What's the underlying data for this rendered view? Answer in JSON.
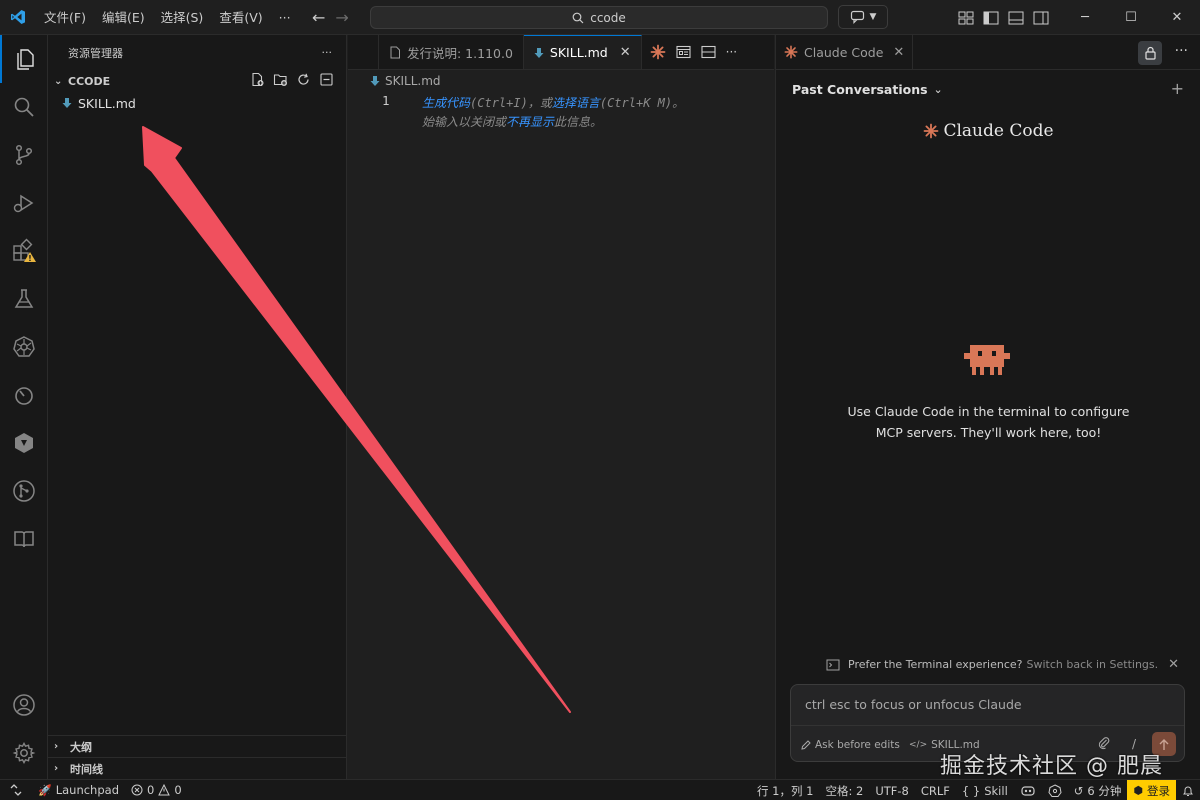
{
  "titlebar": {
    "menu": [
      "文件(F)",
      "编辑(E)",
      "选择(S)",
      "查看(V)",
      "···"
    ],
    "search_text": "ccode",
    "window_controls": [
      "─",
      "☐",
      "✕"
    ]
  },
  "sidebar": {
    "title": "资源管理器",
    "more": "···",
    "folder": "CCODE",
    "files": [
      "SKILL.md"
    ],
    "outline": "大纲",
    "timeline": "时间线"
  },
  "editor": {
    "tabs": [
      {
        "label": "发行说明: 1.110.0",
        "active": false
      },
      {
        "label": "SKILL.md",
        "active": true
      }
    ],
    "tab_more": "···",
    "breadcrumb": "SKILL.md",
    "line_number": "1",
    "hint_line1_a": "生成代码",
    "hint_line1_b": "(Ctrl+I)，或",
    "hint_line1_c": "选择语言",
    "hint_line1_d": "(Ctrl+K M)。",
    "hint_line2_a": "始输入以关闭或",
    "hint_line2_b": "不再显示",
    "hint_line2_c": "此信息。"
  },
  "panel": {
    "tab_label": "Claude Code",
    "more": "···",
    "past_conversations": "Past Conversations",
    "brand": "Claude Code",
    "mcp_line1": "Use Claude Code in the terminal to configure",
    "mcp_line2": "MCP servers. They'll work here, too!",
    "prefer_text": "Prefer the Terminal experience?",
    "prefer_link": "Switch back in Settings.",
    "input_placeholder": "ctrl esc to focus or unfocus Claude",
    "ask_before_edits": "Ask before edits",
    "file_ref": "SKILL.md",
    "slash": "/"
  },
  "statusbar": {
    "launchpad": "Launchpad",
    "errors": "0",
    "warnings": "0",
    "position": "行 1，列 1",
    "spaces": "空格: 2",
    "encoding": "UTF-8",
    "eol": "CRLF",
    "language": "Skill",
    "time": "6 分钟",
    "login": "登录"
  },
  "watermark": "掘金技术社区 @ 肥晨",
  "colors": {
    "accent": "#0078d4",
    "claude_orange": "#d97757",
    "arrow": "#f0505e",
    "login_bg": "#ffcc00"
  }
}
